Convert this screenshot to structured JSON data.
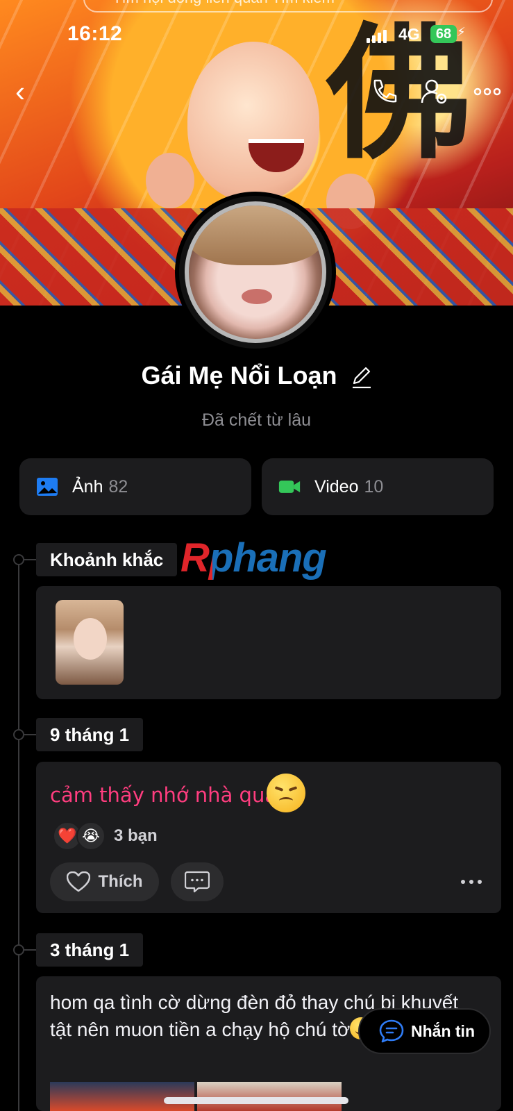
{
  "status_bar": {
    "time": "16:12",
    "network": "4G",
    "battery": "68"
  },
  "cover": {
    "calligraphy_char": "佛"
  },
  "top_search": {
    "text": "Tìm hội đồng liên quan        Tìm kiếm"
  },
  "profile": {
    "name": "Gái Mẹ Nổi Loạn",
    "bio": "Đã chết từ lâu"
  },
  "media": {
    "photos_label": "Ảnh",
    "photos_count": "82",
    "videos_label": "Video",
    "videos_count": "10"
  },
  "watermark": "Rphang",
  "timeline": {
    "moments_label": "Khoảnh khắc",
    "entries": [
      {
        "date": "9 tháng 1",
        "text": "cảm thấy nhớ nhà quá à",
        "reaction_icons": [
          "❤️",
          "😭"
        ],
        "reaction_count": "3 bạn",
        "like_label": "Thích"
      },
      {
        "date": "3 tháng 1",
        "text": "hom qa tình  cờ dừng đèn  đỏ thay chú bi khuyết tật nên muon  tiền a chạy hộ chú tờ"
      }
    ]
  },
  "message_button": {
    "label": "Nhắn tin"
  },
  "colors": {
    "accent_pink": "#ff3d7f",
    "photo_icon": "#1e7cf2",
    "video_icon": "#34c759",
    "battery": "#34c759"
  }
}
